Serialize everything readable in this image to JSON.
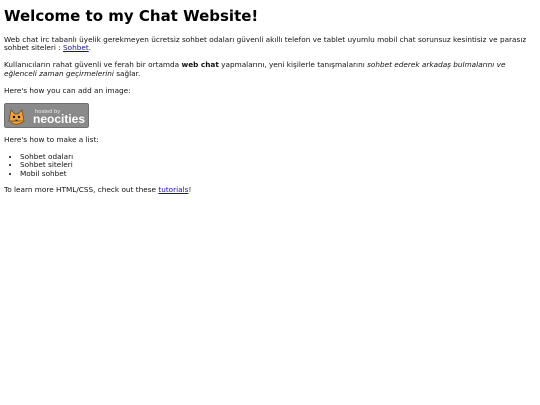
{
  "header": {
    "title": "Welcome to my Chat Website!"
  },
  "intro": {
    "text": "Web chat irc tabanlı üyelik gerekmeyen ücretsiz sohbet odaları güvenli akıllı telefon ve tablet uyumlu mobil chat sorunsuz kesintisiz ve parasız sohbet siteleri : ",
    "link_label": "Sohbet",
    "suffix": "."
  },
  "secondary": {
    "part1": "Kullanıcıların rahat güvenli ve ferah bir ortamda ",
    "bold": "web chat",
    "part2": " yapmalarını, yeni kişilerle tanışmalarını ",
    "italic": "sohbet ederek arkadaş bulmalarını ve eğlenceli zaman geçirmelerini",
    "part3": " sağlar."
  },
  "image_section": {
    "label": "Here's how you can add an image:",
    "badge_text": "hosted by",
    "badge_brand": "neocities",
    "badge_bg": "#8a8a8a"
  },
  "list_section": {
    "label": "Here's how to make a list:",
    "items": [
      "Sohbet odaları",
      "Sohbet siteleri",
      "Mobil sohbet"
    ]
  },
  "footer": {
    "text": "To learn more HTML/CSS, check out these ",
    "link_label": "tutorials",
    "suffix": "!"
  },
  "colors": {
    "link": "#1a0dab",
    "badge_cat": "#f2a13b"
  }
}
